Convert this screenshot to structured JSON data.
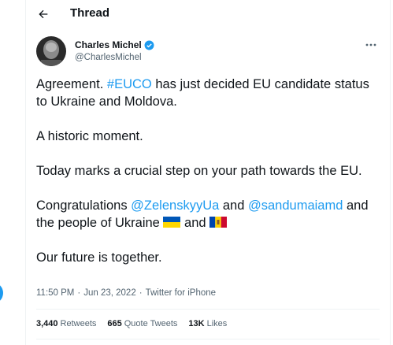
{
  "header": {
    "title": "Thread",
    "back_icon": "arrow-left-icon"
  },
  "author": {
    "name": "Charles Michel",
    "handle": "@CharlesMichel",
    "verified_icon": "verified-badge-icon"
  },
  "tweet": {
    "p1_a": "Agreement. ",
    "p1_tag": "#EUCO",
    "p1_b": " has just decided EU candidate status to Ukraine and Moldova.",
    "p2": "A historic moment.",
    "p3": "Today marks a crucial step on your path towards the EU.",
    "p4_a": "Congratulations ",
    "p4_m1": "@ZelenskyyUa",
    "p4_b": " and ",
    "p4_m2": "@sandumaiamd",
    "p4_c": " and the people of Ukraine ",
    "p4_d": " and ",
    "p5": "Our future is together."
  },
  "meta": {
    "time": "11:50 PM",
    "sep1": "·",
    "date": "Jun 23, 2022",
    "sep2": "·",
    "source": "Twitter for iPhone"
  },
  "stats": {
    "retweets_count": "3,440",
    "retweets_label": "Retweets",
    "quotes_count": "665",
    "quotes_label": "Quote Tweets",
    "likes_count": "13K",
    "likes_label": "Likes"
  },
  "colors": {
    "link": "#1d9bf0",
    "text": "#0f1419",
    "secondary": "#536471"
  },
  "icons": {
    "flag1": "ukraine-flag-icon",
    "flag2": "moldova-flag-icon",
    "more": "more-horizontal-icon"
  }
}
